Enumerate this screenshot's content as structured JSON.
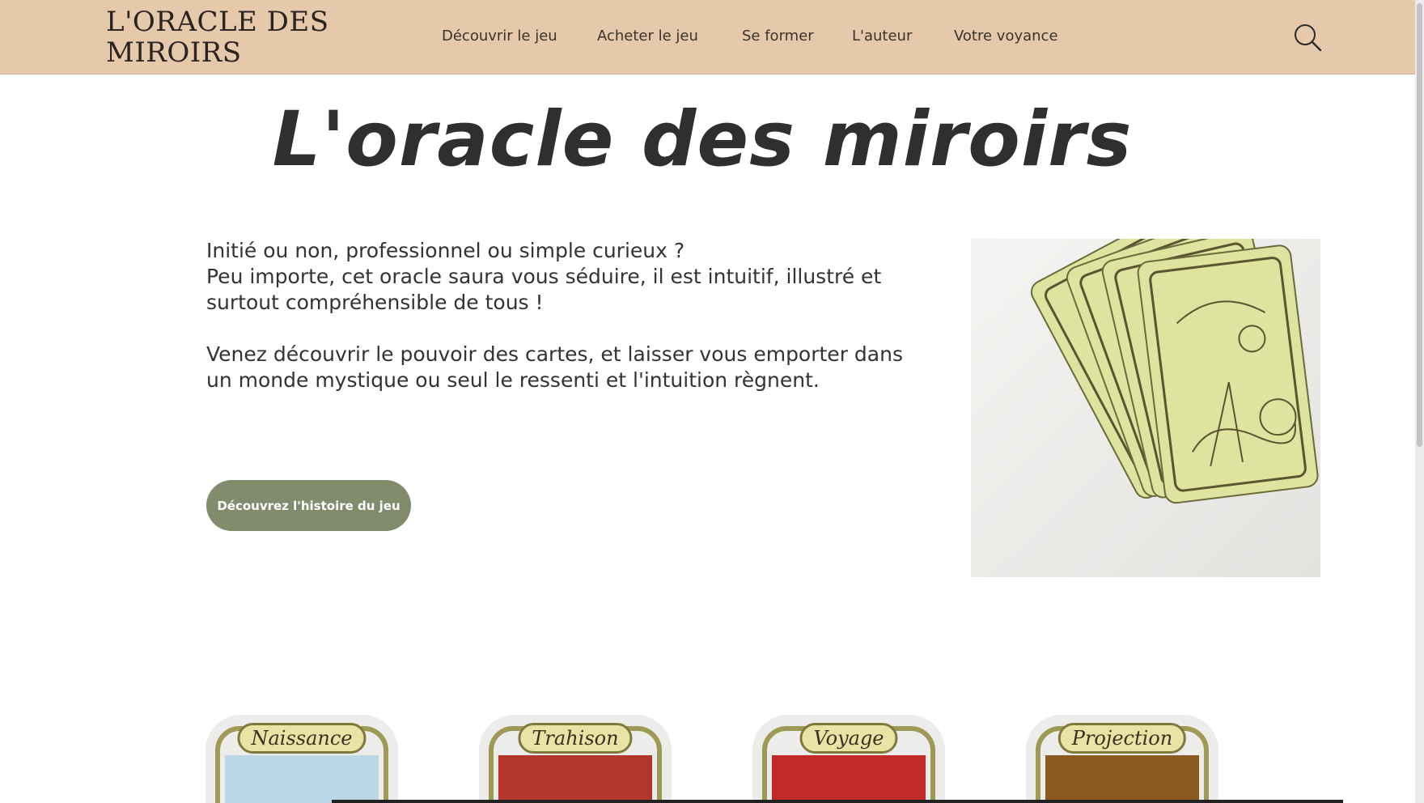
{
  "header": {
    "logo": "L'ORACLE DES MIROIRS",
    "nav": [
      {
        "label": "Découvrir le jeu"
      },
      {
        "label": "Acheter le jeu"
      },
      {
        "label": "Se former"
      },
      {
        "label": "L'auteur"
      },
      {
        "label": "Votre voyance"
      }
    ],
    "search_icon": "search-icon"
  },
  "hero": {
    "title": "L'oracle des miroirs",
    "paragraph1_line1": "Initié ou non, professionnel ou simple curieux ?",
    "paragraph1_line2": "Peu importe, cet oracle saura vous séduire, il est intuitif, illustré et surtout compréhensible de tous !",
    "paragraph2": "Venez découvrir le pouvoir des cartes, et laisser vous emporter dans un monde mystique ou seul le ressenti et l'intuition règnent.",
    "cta_label": "Découvrez l'histoire du jeu"
  },
  "cards": [
    {
      "label": "Naissance",
      "color": "#bcd8e6"
    },
    {
      "label": "Trahison",
      "color": "#b4362a"
    },
    {
      "label": "Voyage",
      "color": "#c22a28"
    },
    {
      "label": "Projection",
      "color": "#8a5a22"
    }
  ],
  "colors": {
    "header_bg": "#e6c8ab",
    "button_bg": "#838b6d",
    "card_yellow": "#dfe3a0"
  }
}
